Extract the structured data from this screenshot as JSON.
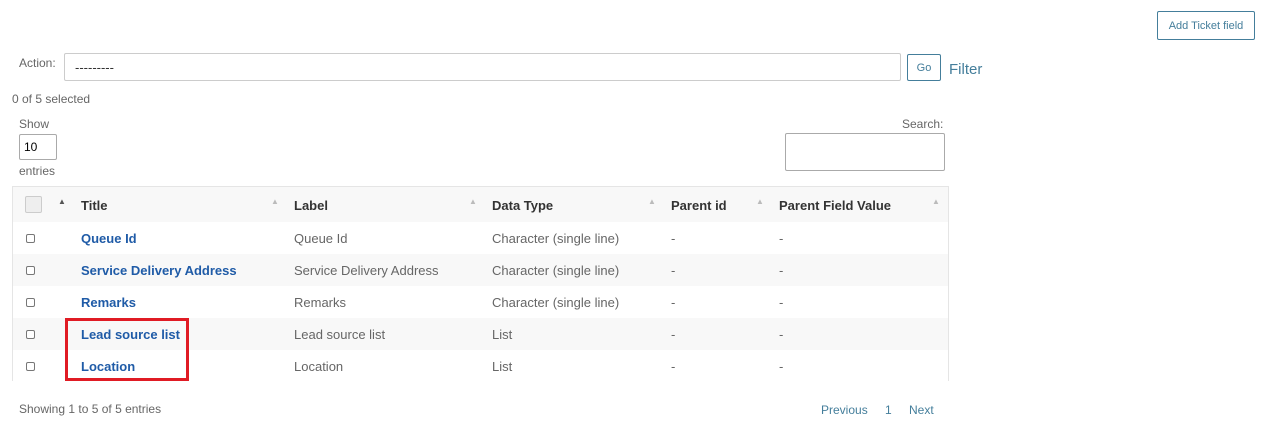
{
  "toolbar": {
    "add_label": "Add Ticket field"
  },
  "actions": {
    "label": "Action:",
    "selected_option": "---------",
    "go_label": "Go",
    "filter_label": "Filter",
    "selected_count": "0 of 5 selected"
  },
  "length": {
    "show_label": "Show",
    "value": "10",
    "entries_label": "entries"
  },
  "search": {
    "label": "Search:",
    "value": ""
  },
  "table": {
    "columns": [
      "Title",
      "Label",
      "Data Type",
      "Parent id",
      "Parent Field Value"
    ],
    "rows": [
      {
        "title": "Queue Id",
        "label": "Queue Id",
        "data_type": "Character (single line)",
        "parent_id": "-",
        "parent_value": "-"
      },
      {
        "title": "Service Delivery Address",
        "label": "Service Delivery Address",
        "data_type": "Character (single line)",
        "parent_id": "-",
        "parent_value": "-"
      },
      {
        "title": "Remarks",
        "label": "Remarks",
        "data_type": "Character (single line)",
        "parent_id": "-",
        "parent_value": "-"
      },
      {
        "title": "Lead source list",
        "label": "Lead source list",
        "data_type": "List",
        "parent_id": "-",
        "parent_value": "-"
      },
      {
        "title": "Location",
        "label": "Location",
        "data_type": "List",
        "parent_id": "-",
        "parent_value": "-"
      }
    ]
  },
  "footer": {
    "info": "Showing 1 to 5 of 5 entries",
    "previous": "Previous",
    "page": "1",
    "next": "Next"
  },
  "colors": {
    "accent": "#447e9b",
    "link": "#1f5ba7",
    "highlight": "#e01b24"
  }
}
